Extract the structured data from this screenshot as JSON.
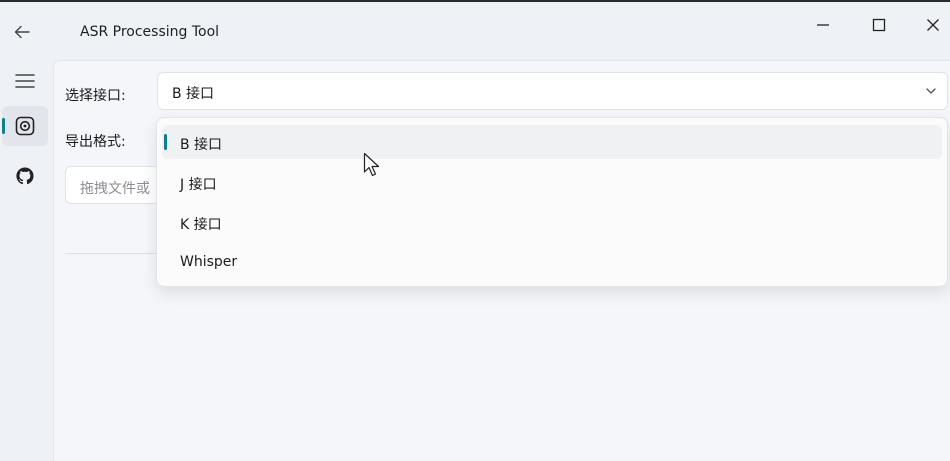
{
  "window": {
    "title": "ASR Processing Tool"
  },
  "form": {
    "interface_label": "选择接口:",
    "interface_value": "B 接口",
    "export_label": "导出格式:",
    "drop_placeholder": "拖拽文件或"
  },
  "dropdown": {
    "options": [
      "B 接口",
      "J 接口",
      "K 接口",
      "Whisper"
    ],
    "selected_index": 0
  },
  "colors": {
    "accent": "#0f7f8a",
    "background": "#eef1f6"
  },
  "icons": {
    "back": "arrow-left-icon",
    "menu": "hamburger-menu-icon",
    "active_page": "target-icon",
    "github": "github-icon",
    "minimize": "minimize-icon",
    "maximize": "maximize-icon",
    "close": "close-icon",
    "chevron": "chevron-down-icon"
  }
}
